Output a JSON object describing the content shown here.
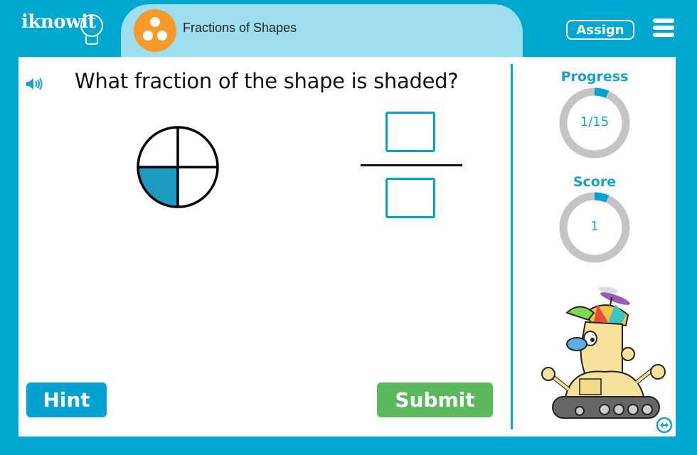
{
  "header": {
    "logo_text": "iknowit",
    "lesson_title": "Fractions of Shapes",
    "assign_label": "Assign",
    "menu_icon": "hamburger-menu-icon",
    "lesson_icon": "three-dots-circle-icon"
  },
  "question": {
    "audio_icon": "speaker-icon",
    "text": "What fraction of the shape is shaded?",
    "shape": {
      "type": "circle",
      "parts": 4,
      "shaded_parts": 1,
      "shaded_quadrant": "bottom-left"
    },
    "answer": {
      "numerator": "",
      "denominator": ""
    }
  },
  "buttons": {
    "hint_label": "Hint",
    "submit_label": "Submit"
  },
  "sidebar": {
    "progress": {
      "label": "Progress",
      "value_text": "1/15",
      "current": 1,
      "total": 15
    },
    "score": {
      "label": "Score",
      "value_text": "1",
      "fraction_shown": 0.067
    },
    "mascot": "robot-mascot",
    "expand_icon": "expand-horizontal-icon"
  },
  "colors": {
    "brand_blue": "#00a8cf",
    "title_tab": "#9ddff0",
    "lesson_orange": "#f59a2a",
    "shaded": "#1a9bc0",
    "submit_green": "#5cb85c",
    "ring_gray": "#c4c4c4"
  }
}
